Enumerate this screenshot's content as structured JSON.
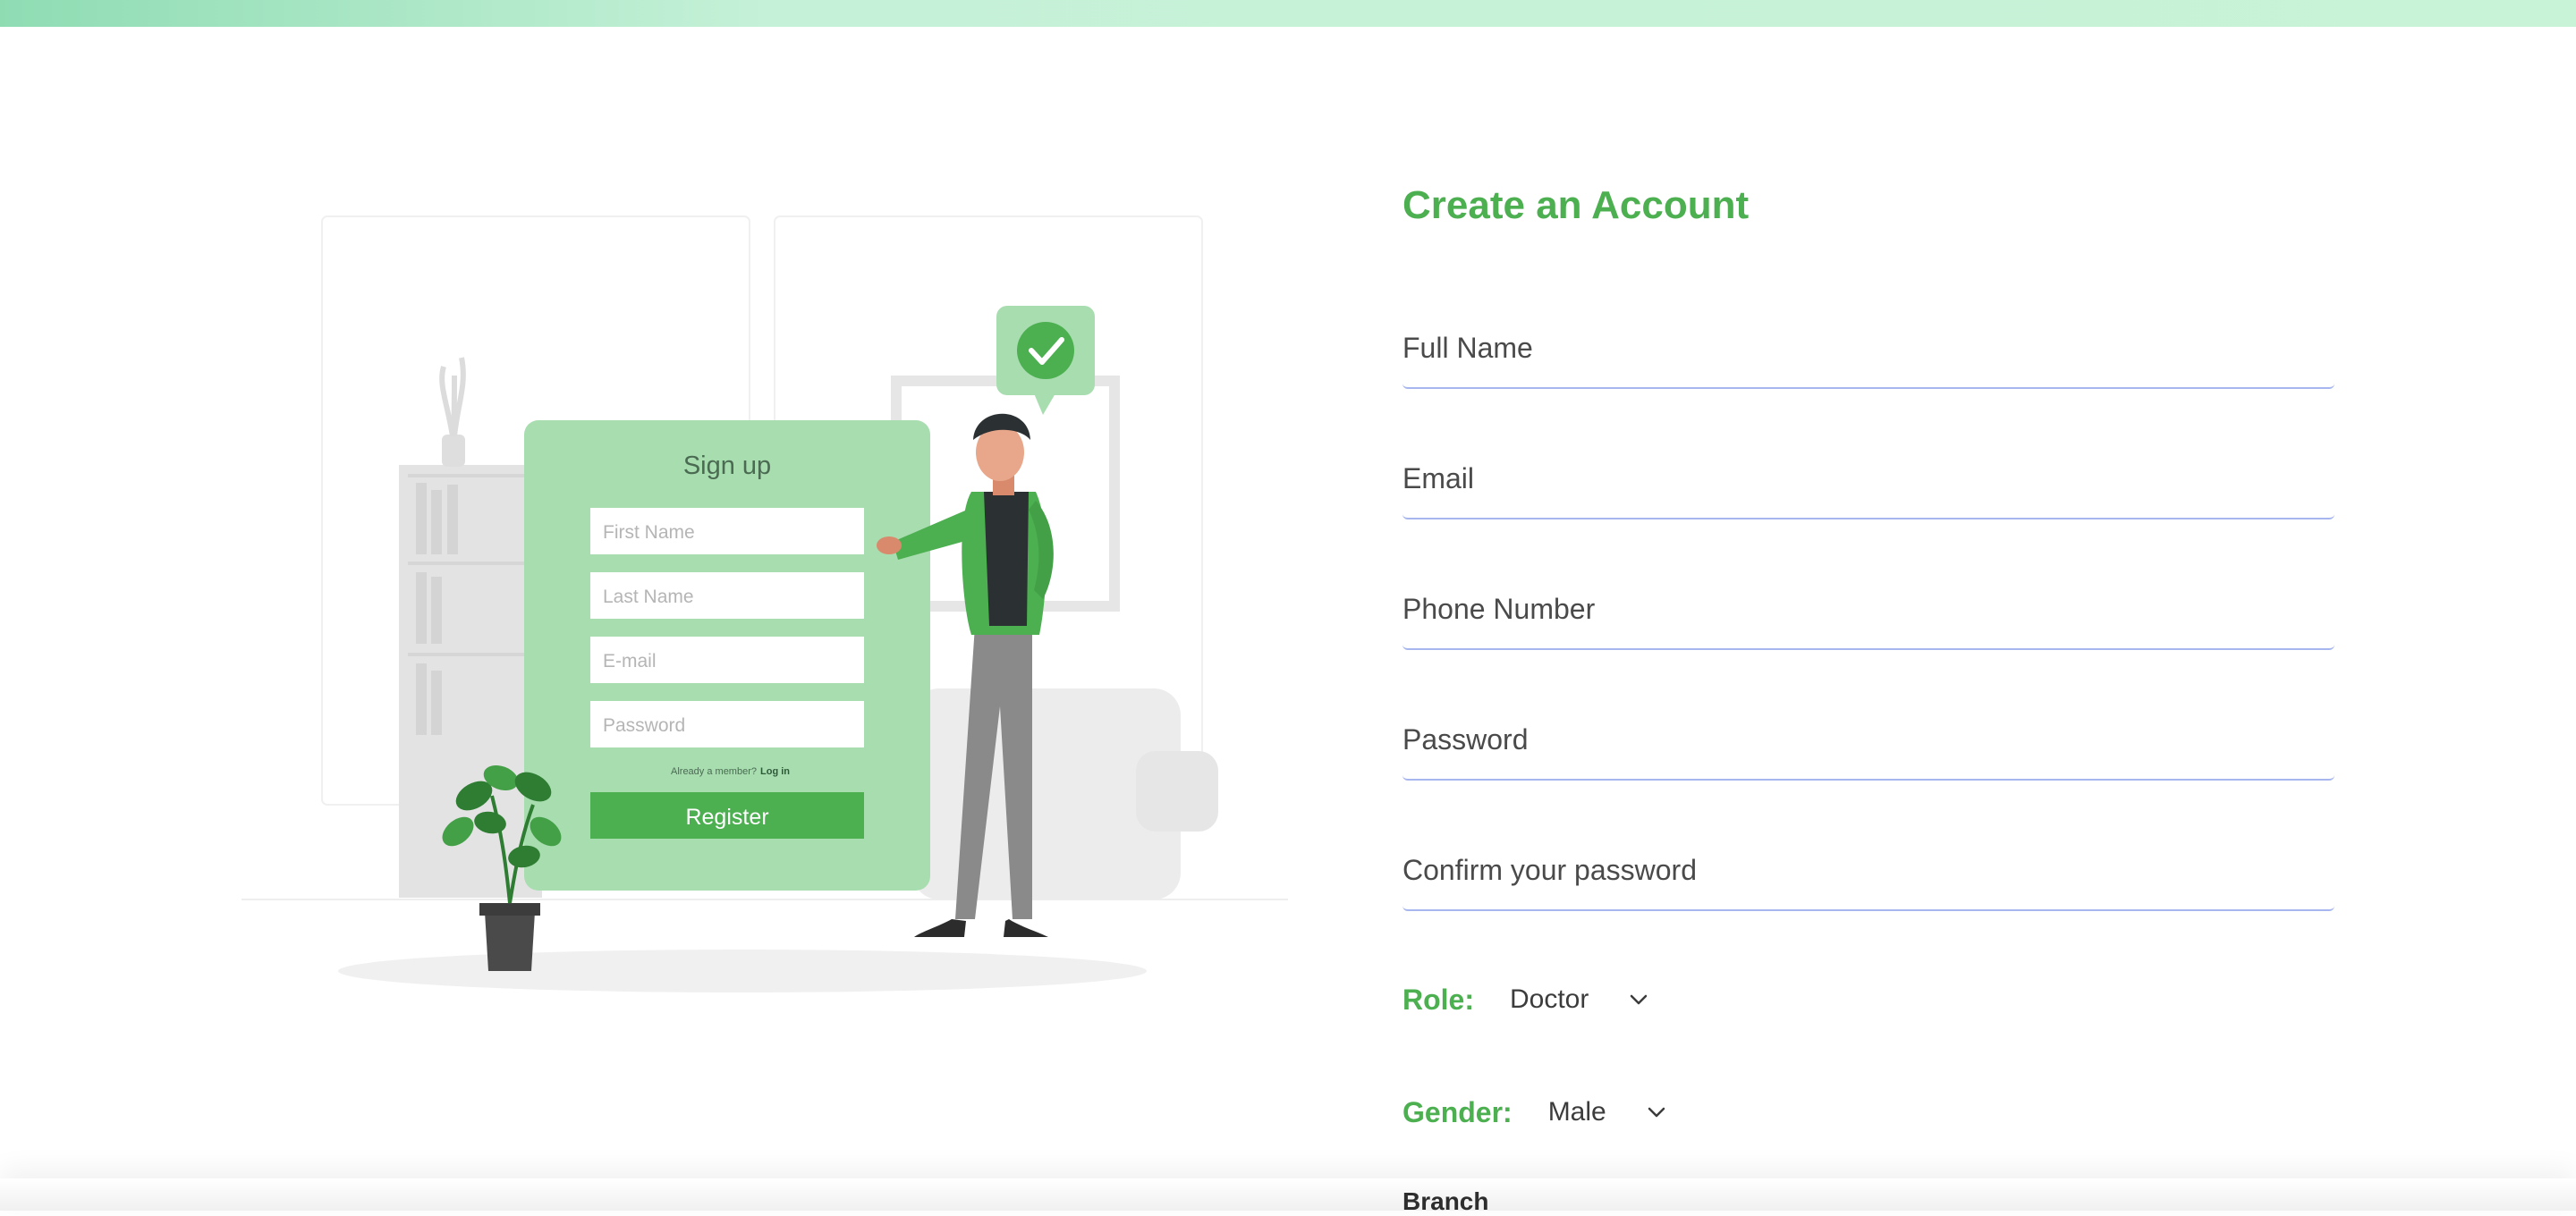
{
  "form": {
    "title": "Create an Account",
    "fields": {
      "full_name": {
        "placeholder": "Full Name",
        "value": ""
      },
      "email": {
        "placeholder": "Email",
        "value": ""
      },
      "phone": {
        "placeholder": "Phone Number",
        "value": ""
      },
      "password": {
        "placeholder": "Password",
        "value": ""
      },
      "confirm_password": {
        "placeholder": "Confirm your password",
        "value": ""
      }
    },
    "role": {
      "label": "Role:",
      "selected": "Doctor"
    },
    "gender": {
      "label": "Gender:",
      "selected": "Male"
    },
    "branch": {
      "label": "Branch"
    }
  },
  "illustration": {
    "card_title": "Sign up",
    "inputs": [
      "First Name",
      "Last Name",
      "E-mail",
      "Password"
    ],
    "member_text": "Already a member?",
    "login_link": "Log in",
    "register_button": "Register"
  },
  "colors": {
    "accent": "#4caf50",
    "card": "#a8ddb0",
    "underline": "#a7b6ee",
    "top_bar": "#c5f1d8"
  },
  "icons": {
    "check": "check-icon",
    "chevron": "chevron-down-icon"
  }
}
